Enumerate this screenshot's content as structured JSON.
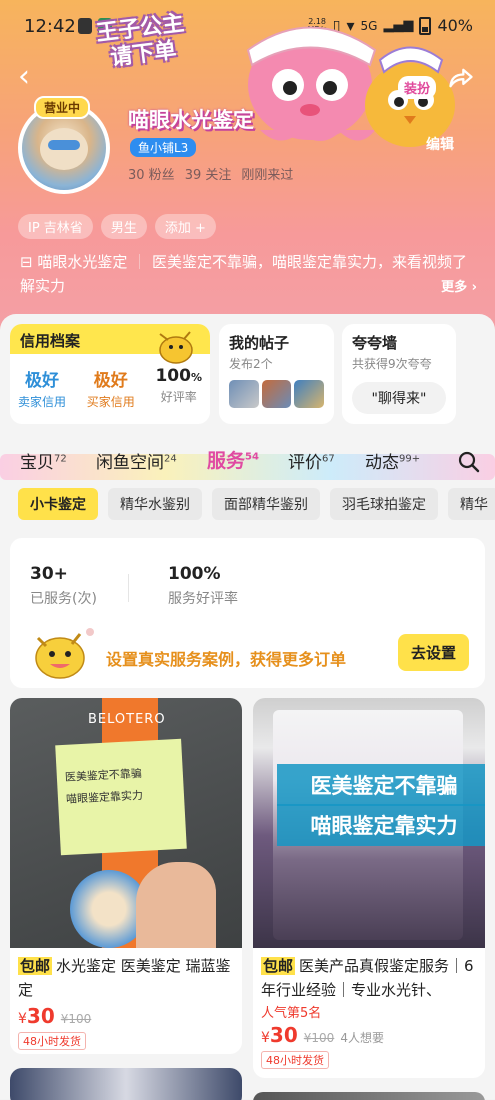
{
  "status_bar": {
    "time": "12:42",
    "net_speed_top": "2.18",
    "net_speed_bottom": "MB/s",
    "network": "5G",
    "battery": "40%"
  },
  "header": {
    "banner_title_line1": "王子公主",
    "banner_title_line2": "请下单",
    "dress_up_label": "装扮",
    "edit_label": "编辑",
    "open_badge": "营业中",
    "shop_name": "喵眼水光鉴定",
    "level_badge": "鱼小铺L3",
    "fans": "30 粉丝",
    "following": "39 关注",
    "last_seen": "刚刚来过",
    "tags": [
      "IP 吉林省",
      "男生",
      "添加 +"
    ],
    "desc_name": "喵眼水光鉴定",
    "desc_text": "医美鉴定不靠骗，喵眼鉴定靠实力，来看视频了解实力",
    "more_label": "更多"
  },
  "credit": {
    "title": "信用档案",
    "seller_value": "极好",
    "seller_label": "卖家信用",
    "buyer_value": "极好",
    "buyer_label": "买家信用",
    "rating_value": "100",
    "rating_unit": "%",
    "rating_label": "好评率"
  },
  "posts": {
    "title": "我的帖子",
    "subtitle": "发布2个"
  },
  "praise": {
    "title": "夸夸墙",
    "subtitle": "共获得9次夸夸",
    "button": "\"聊得来\""
  },
  "tabs": [
    {
      "label": "宝贝",
      "count": "72"
    },
    {
      "label": "闲鱼空间",
      "count": "24"
    },
    {
      "label": "服务",
      "count": "54"
    },
    {
      "label": "评价",
      "count": "67"
    },
    {
      "label": "动态",
      "count": "99+"
    }
  ],
  "chips": [
    "小卡鉴定",
    "精华水鉴别",
    "面部精华鉴别",
    "羽毛球拍鉴定",
    "精华"
  ],
  "service": {
    "served_value": "30+",
    "served_label": "已服务(次)",
    "rate_value": "100%",
    "rate_label": "服务好评率",
    "hint": "设置真实服务案例，获得更多订单",
    "button": "去设置"
  },
  "products": [
    {
      "badge": "包邮",
      "title": "水光鉴定 医美鉴定 瑞蓝鉴定",
      "image_brand": "BELOTERO",
      "image_note_line1": "医美鉴定不靠骗",
      "image_note_line2": "喵眼鉴定靠实力",
      "price_symbol": "¥",
      "price": "30",
      "orig_price": "¥100",
      "ship": "48小时发货"
    },
    {
      "badge": "包邮",
      "title": "医美产品真假鉴定服务｜6年行业经验｜专业水光针、",
      "overlay_line1": "医美鉴定不靠骗",
      "overlay_line2": "喵眼鉴定靠实力",
      "popular": "人气第5名",
      "price_symbol": "¥",
      "price": "30",
      "orig_price": "¥100",
      "wants": "4人想要",
      "ship": "48小时发货"
    }
  ],
  "colors": {
    "accent_yellow": "#ffe14a",
    "price_red": "#ef3a2d",
    "tab_active": "#e04aa2",
    "hint_orange": "#e6901c"
  }
}
